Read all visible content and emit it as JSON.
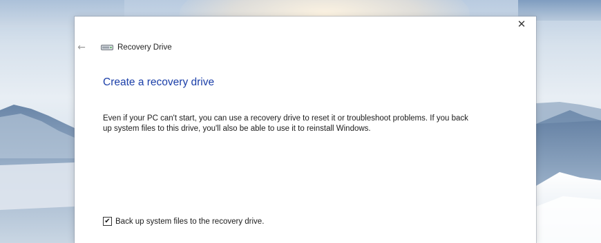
{
  "window": {
    "close_glyph": "✕",
    "nav": {
      "back_glyph": "←",
      "title": "Recovery Drive",
      "icon": "drive-icon"
    },
    "heading": "Create a recovery drive",
    "description": "Even if your PC can't start, you can use a recovery drive to reset it or troubleshoot problems. If you back up system files to this drive, you'll also be able to use it to reinstall Windows.",
    "backup_checkbox": {
      "checked": true,
      "check_glyph": "✔",
      "label": "Back up system files to the recovery drive."
    }
  },
  "colors": {
    "heading": "#1a3ea8",
    "window_bg": "#ffffff"
  }
}
